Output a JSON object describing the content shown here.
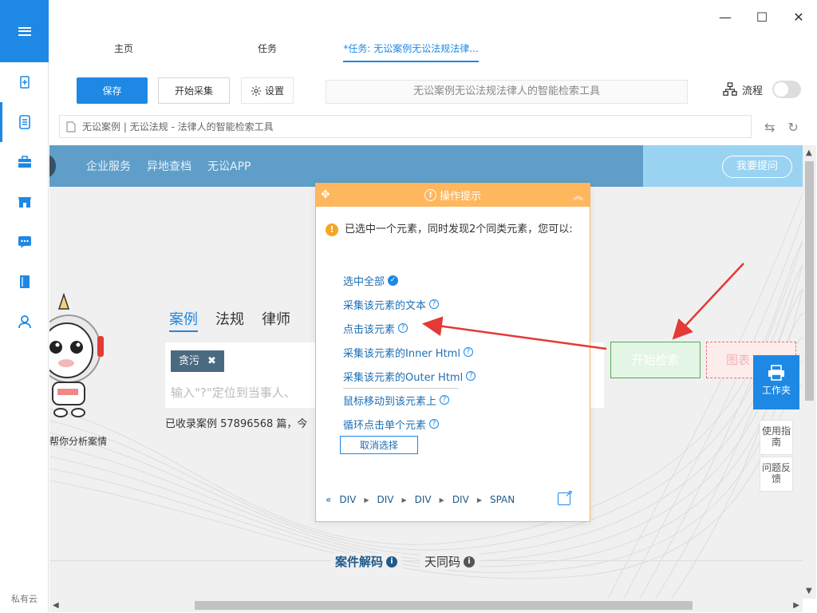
{
  "window": {
    "minimize": "—",
    "maximize": "☐",
    "close": "✕"
  },
  "sidebar": {
    "footer": "私有云",
    "icons": [
      "add-doc-icon",
      "document-icon",
      "briefcase-icon",
      "store-icon",
      "chat-icon",
      "book-icon",
      "user-icon"
    ]
  },
  "tabs": [
    {
      "label": "主页"
    },
    {
      "label": "任务"
    },
    {
      "label": "*任务: 无讼案例无讼法规法律..."
    }
  ],
  "toolbar": {
    "save": "保存",
    "start_collect": "开始采集",
    "settings": "设置",
    "title": "无讼案例无讼法规法律人的智能检索工具",
    "flow": "流程"
  },
  "address": {
    "text": "无讼案例 | 无讼法规 - 法律人的智能检索工具"
  },
  "webpage": {
    "nav": [
      "企业服务",
      "异地查档",
      "无讼APP"
    ],
    "ask": "我要提问",
    "search_tabs": [
      "案例",
      "法规",
      "律师"
    ],
    "tag": "贪污",
    "tag_close": "✖",
    "placeholder": "输入\"?\"定位到当事人、",
    "stat": "已收录案例 57896568 篇，今",
    "mascot_caption": "帮你分析案情",
    "start_search": "开始检索",
    "adv_search": "图表",
    "bottom_link1": "案件解码",
    "bottom_link2": "天同码",
    "workspace": "工作夹",
    "help1": "使用指南",
    "help2": "问题反馈"
  },
  "popup": {
    "title": "操作提示",
    "message": "已选中一个元素，同时发现2个同类元素，您可以:",
    "options": [
      "选中全部",
      "采集该元素的文本",
      "点击该元素",
      "采集该元素的Inner Html",
      "采集该元素的Outer Html",
      "鼠标移动到该元素上",
      "循环点击单个元素"
    ],
    "cancel": "取消选择",
    "crumbs": [
      "DIV",
      "DIV",
      "DIV",
      "DIV",
      "SPAN"
    ],
    "crumbs_back": "«"
  },
  "colors": {
    "accent": "#1e88e5",
    "popup_header": "#ffb75e",
    "arrow": "#e53935"
  }
}
